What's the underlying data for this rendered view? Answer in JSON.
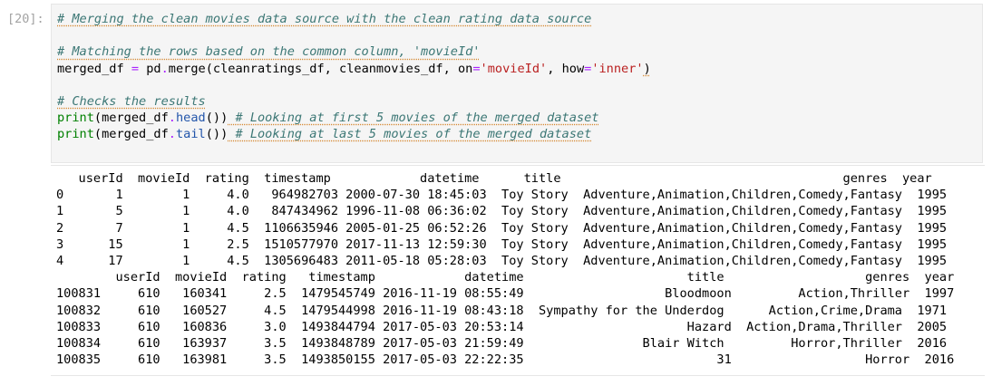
{
  "cell": {
    "prompt": "[20]:",
    "code_lines": [
      [
        {
          "t": "# Merging the clean movies data source with the clean rating data source",
          "k": "comment"
        }
      ],
      [],
      [
        {
          "t": "# Matching the rows based on the common column, 'movieId'",
          "k": "comment"
        }
      ],
      [
        {
          "t": "merged_df ",
          "k": "plain"
        },
        {
          "t": "=",
          "k": "op"
        },
        {
          "t": " pd",
          "k": "plain"
        },
        {
          "t": ".",
          "k": "op"
        },
        {
          "t": "merge(cleanratings_df, cleanmovies_df, on",
          "k": "plain"
        },
        {
          "t": "=",
          "k": "op"
        },
        {
          "t": "'movieId'",
          "k": "str"
        },
        {
          "t": ", how",
          "k": "plain"
        },
        {
          "t": "=",
          "k": "op"
        },
        {
          "t": "'inner'",
          "k": "str"
        },
        {
          "t": ")",
          "k": "squiggle"
        }
      ],
      [],
      [
        {
          "t": "# Checks the results",
          "k": "comment"
        }
      ],
      [
        {
          "t": "print",
          "k": "builtin"
        },
        {
          "t": "(merged_df",
          "k": "plain"
        },
        {
          "t": ".",
          "k": "op"
        },
        {
          "t": "head",
          "k": "attr"
        },
        {
          "t": "())",
          "k": "plain"
        },
        {
          "t": " # Looking at first 5 movies of the merged dataset",
          "k": "comment"
        }
      ],
      [
        {
          "t": "print",
          "k": "builtin"
        },
        {
          "t": "(merged_df",
          "k": "plain"
        },
        {
          "t": ".",
          "k": "op"
        },
        {
          "t": "tail",
          "k": "attr"
        },
        {
          "t": "())",
          "k": "plain"
        },
        {
          "t": " # Looking at last 5 movies of the merged dataset",
          "k": "comment"
        }
      ]
    ],
    "output_lines": [
      "   userId  movieId  rating  timestamp            datetime      title                                      genres  year",
      "0       1        1     4.0   964982703 2000-07-30 18:45:03  Toy Story  Adventure,Animation,Children,Comedy,Fantasy  1995",
      "1       5        1     4.0   847434962 1996-11-08 06:36:02  Toy Story  Adventure,Animation,Children,Comedy,Fantasy  1995",
      "2       7        1     4.5  1106635946 2005-01-25 06:52:26  Toy Story  Adventure,Animation,Children,Comedy,Fantasy  1995",
      "3      15        1     2.5  1510577970 2017-11-13 12:59:30  Toy Story  Adventure,Animation,Children,Comedy,Fantasy  1995",
      "4      17        1     4.5  1305696483 2011-05-18 05:28:03  Toy Story  Adventure,Animation,Children,Comedy,Fantasy  1995",
      "        userId  movieId  rating   timestamp            datetime                      title                   genres  year",
      "100831     610   160341     2.5  1479545749 2016-11-19 08:55:49                   Bloodmoon         Action,Thriller  1997",
      "100832     610   160527     4.5  1479544998 2016-11-19 08:43:18  Sympathy for the Underdog      Action,Crime,Drama  1971",
      "100833     610   160836     3.0  1493844794 2017-05-03 20:53:14                      Hazard  Action,Drama,Thriller  2005",
      "100834     610   163937     3.5  1493848789 2017-05-03 21:59:49                Blair Witch         Horror,Thriller  2016",
      "100835     610   163981     3.5  1493850155 2017-05-03 22:22:35                          31                  Horror  2016"
    ]
  }
}
